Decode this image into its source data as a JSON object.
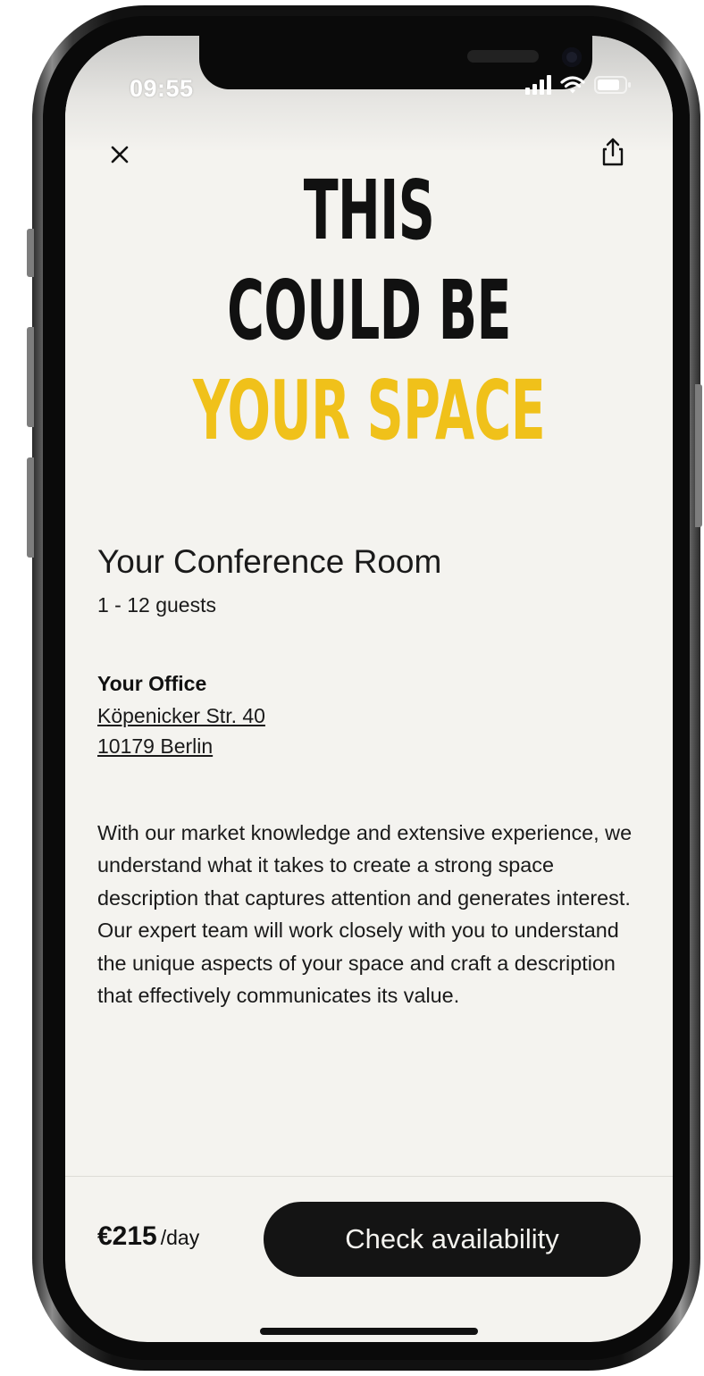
{
  "status_bar": {
    "time": "09:55",
    "icons": [
      "signal-icon",
      "wifi-icon",
      "battery-icon"
    ]
  },
  "toolbar": {
    "close_icon": "close-icon",
    "share_icon": "share-icon"
  },
  "hero": {
    "line1": "THIS",
    "line2": "COULD BE",
    "line3": "YOUR SPACE",
    "accent_color": "#f0c11a"
  },
  "room": {
    "title": "Your Conference Room",
    "guests": "1 - 12 guests"
  },
  "office": {
    "name": "Your Office",
    "street": "Köpenicker Str. 40",
    "city": "10179 Berlin"
  },
  "description": "With our market knowledge and extensive experience, we understand what it takes to create a strong space description that captures attention and generates interest. Our expert team will work closely with you to understand the unique aspects of your space and craft a description that effectively communicates its value.",
  "footer": {
    "price_amount": "€215",
    "price_unit": "/day",
    "cta_label": "Check availability"
  }
}
